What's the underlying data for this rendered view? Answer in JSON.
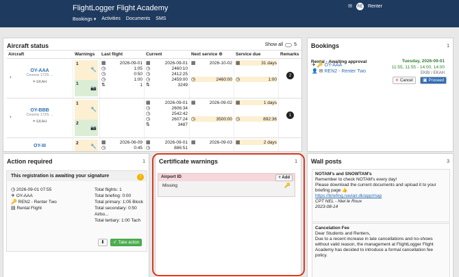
{
  "app": {
    "title": "FlightLogger Flight Academy",
    "user": "Renter",
    "avatar": "RE"
  },
  "nav": {
    "bookings": "Bookings",
    "activities": "Activities",
    "documents": "Documents",
    "sms": "SMS"
  },
  "aircraft_status": {
    "title": "Aircraft status",
    "show_all": "Show all",
    "count": "5",
    "headers": {
      "aircraft": "Aircraft",
      "warnings": "Warnings",
      "last_flight": "Last flight",
      "current": "Current",
      "next_service": "Next service",
      "service_due": "Service due",
      "remarks": "Remarks"
    },
    "rows": [
      {
        "reg": "OY-AAA",
        "model": "Cessna 172S ...",
        "home": "EKAH",
        "w1": "1",
        "w2": "1",
        "last": [
          "2026-09-01",
          "1:05",
          "0:50",
          "1:00",
          "1"
        ],
        "current": [
          "2026-09-01",
          "2460:10",
          "2412:25",
          "2459:00",
          "3249"
        ],
        "next": [
          "2026-10-02",
          "2460:00"
        ],
        "due": [
          "31 days",
          "1:00"
        ],
        "remark": "2"
      },
      {
        "reg": "OY-BBB",
        "model": "Cessna 172S ...",
        "home": "EKAH",
        "w1": "1",
        "w2": "2",
        "last": [],
        "current": [
          "2026-09-01",
          "2606:34",
          "2542:42",
          "2607:24",
          "3487"
        ],
        "next": [
          "2026-09-02",
          "3500:00"
        ],
        "due": [
          "1 days",
          "892:36"
        ],
        "remark": "1"
      },
      {
        "reg": "OY-III",
        "model": "",
        "home": "",
        "w1": "2",
        "w2": "",
        "last": [
          "2026-06-09",
          "0:45"
        ],
        "current": [
          "2026-09-01",
          "886:51"
        ],
        "next": [
          "2026-09-03"
        ],
        "due": [
          "2 days"
        ],
        "remark": ""
      }
    ]
  },
  "bookings": {
    "title": "Bookings",
    "count": "1",
    "label": "Rental - Awaiting approval",
    "date": "Tuesday, 2026-09-01",
    "time_a": "11:55",
    "time_b": "11:55 - 14:00",
    "time_c": "14:00",
    "route": "EKBI / EKAH",
    "aircraft": "OY-AAA",
    "person": "REN2 - Renter Two",
    "cancel": "Cancel",
    "proceed": "Proceed"
  },
  "action_required": {
    "title": "Action required",
    "count": "1",
    "message": "This registration is awaiting your signature",
    "date": "2026-09-01 07:55",
    "aircraft": "OY-AAA",
    "renter": "REN2 - Renter Two",
    "type": "Rental Flight",
    "stats": [
      "Total flights: 1",
      "Total briefing: 0:00",
      "Total primary: 1:05 Block",
      "Total secondary: 0:50 Airbo...",
      "Total tertiary: 1:00 Tach"
    ],
    "take": "Take action"
  },
  "certificate": {
    "title": "Certificate warnings",
    "count": "1",
    "head": "Airport ID",
    "add": "+ Add",
    "status": "Missing"
  },
  "wall": {
    "title": "Wall posts",
    "count": "3",
    "p1_title": "NOTAM's and SNOWTAM's",
    "p1_l1": "Remember to check NOTAM's every day!",
    "p1_l2": "Please download the current documents and upload it to your",
    "p1_l3": "briefing page 👍",
    "p1_link": "https://briefing.naviair.dk/app/map",
    "p1_author": "CPT NEL - Niel le Roux",
    "p1_date": "2023-08-14",
    "p2_title": "Cancelation Fee",
    "p2_l1": "Dear Students and Renters,",
    "p2_l2": "Due to a recent increase in late cancellations and no-shows",
    "p2_l3": "without valid reason, the management at FlightLogger Flight",
    "p2_l4": "Academy has decided to introduce a formal cancellation fee",
    "p2_l5": "policy."
  }
}
